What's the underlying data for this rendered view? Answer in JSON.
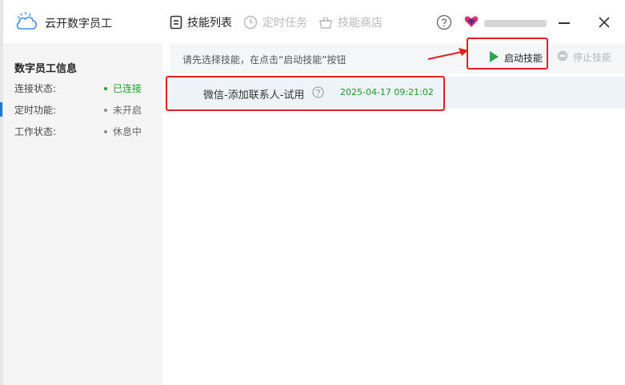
{
  "app": {
    "name": "云开数字员工"
  },
  "nav": [
    {
      "label": "技能列表",
      "icon": "list-icon",
      "active": true
    },
    {
      "label": "定时任务",
      "icon": "clock-icon",
      "active": false
    },
    {
      "label": "技能商店",
      "icon": "store-icon",
      "active": false
    }
  ],
  "sidebar": {
    "title": "数字员工信息",
    "rows": [
      {
        "key": "连接状态:",
        "value": "已连接",
        "status": "ok"
      },
      {
        "key": "定时功能:",
        "value": "未开启",
        "status": "off"
      },
      {
        "key": "工作状态:",
        "value": "休息中",
        "status": "off"
      }
    ]
  },
  "toolbar": {
    "hint": "请先选择技能，在点击“启动技能”按钮",
    "start_label": "启动技能",
    "stop_label": "停止技能"
  },
  "skills": [
    {
      "name": "微信-添加联系人-试用",
      "time": "2025-04-17 09:21:02"
    }
  ],
  "colors": {
    "accent_red": "#e02020",
    "status_green": "#1aa32b",
    "start_green": "#2ea44f",
    "brand_blue": "#3a8ee6"
  }
}
